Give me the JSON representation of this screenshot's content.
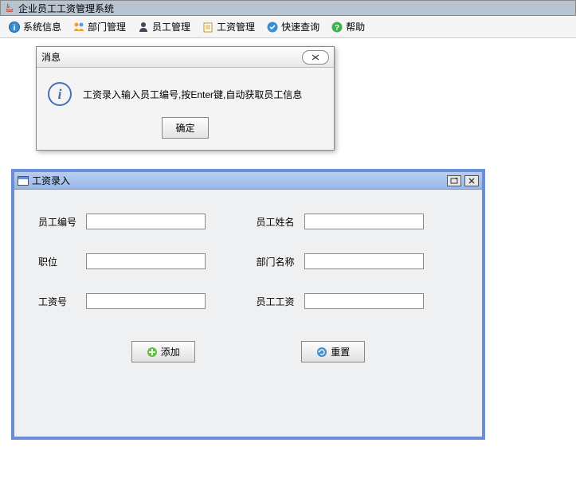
{
  "window": {
    "title": "企业员工工资管理系统"
  },
  "menu": {
    "items": [
      {
        "label": "系统信息",
        "icon": "info-icon"
      },
      {
        "label": "部门管理",
        "icon": "dept-icon"
      },
      {
        "label": "员工管理",
        "icon": "user-icon"
      },
      {
        "label": "工资管理",
        "icon": "salary-icon"
      },
      {
        "label": "快速查询",
        "icon": "search-icon"
      },
      {
        "label": "帮助",
        "icon": "help-icon"
      }
    ]
  },
  "dialog": {
    "title": "消息",
    "message": "工资录入输入员工编号,按Enter键,自动获取员工信息",
    "ok_label": "确定"
  },
  "internal_frame": {
    "title": "工资录入",
    "fields": {
      "emp_id": {
        "label": "员工编号",
        "value": ""
      },
      "emp_name": {
        "label": "员工姓名",
        "value": ""
      },
      "position": {
        "label": "职位",
        "value": ""
      },
      "dept_name": {
        "label": "部门名称",
        "value": ""
      },
      "salary_id": {
        "label": "工资号",
        "value": ""
      },
      "emp_salary": {
        "label": "员工工资",
        "value": ""
      }
    },
    "buttons": {
      "add": "添加",
      "reset": "重置"
    }
  }
}
